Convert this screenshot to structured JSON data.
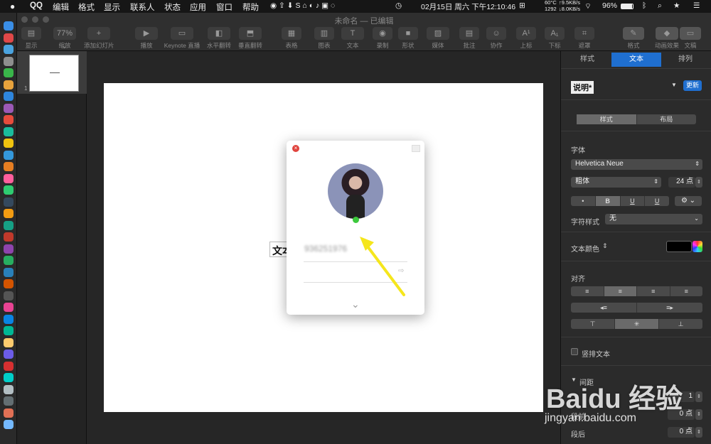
{
  "menubar": {
    "apple": "",
    "items": [
      "QQ",
      "编辑",
      "格式",
      "显示",
      "联系人",
      "状态",
      "应用",
      "窗口",
      "帮助"
    ],
    "cpu_temp": "60°C",
    "fan": "1292",
    "net_up": "↑9.5KB/s",
    "net_down": "↓8.0KB/s",
    "clock": "02月15日 周六 下午12:10:46",
    "battery": "96%"
  },
  "window": {
    "title": "未命名 — 已编辑"
  },
  "toolbar": {
    "items": [
      {
        "label": "显示",
        "icon": "view-icon"
      },
      {
        "label": "缩放",
        "value": "77%"
      },
      {
        "label": "添加幻灯片",
        "icon": "plus-icon"
      },
      {
        "label": "播放",
        "icon": "play-icon"
      },
      {
        "label": "Keynote 直播",
        "icon": "live-icon"
      },
      {
        "label": "水平翻转",
        "icon": "flip-h-icon"
      },
      {
        "label": "垂直翻转",
        "icon": "flip-v-icon"
      },
      {
        "label": "表格",
        "icon": "table-icon"
      },
      {
        "label": "图表",
        "icon": "chart-icon"
      },
      {
        "label": "文本",
        "icon": "text-icon"
      },
      {
        "label": "录制",
        "icon": "record-icon"
      },
      {
        "label": "形状",
        "icon": "shape-icon"
      },
      {
        "label": "媒体",
        "icon": "media-icon"
      },
      {
        "label": "批注",
        "icon": "comment-icon"
      },
      {
        "label": "协作",
        "icon": "collab-icon"
      },
      {
        "label": "上标",
        "icon": "superscript-icon"
      },
      {
        "label": "下标",
        "icon": "subscript-icon"
      },
      {
        "label": "遮罩",
        "icon": "mask-icon"
      },
      {
        "label": "格式",
        "icon": "format-icon"
      },
      {
        "label": "动画效果",
        "icon": "animate-icon"
      },
      {
        "label": "文稿",
        "icon": "document-icon"
      }
    ]
  },
  "thumbnails": {
    "slide_number": "1"
  },
  "slide": {
    "text_box": "文本"
  },
  "qq_login": {
    "account": "936251976",
    "chevron": "⌄"
  },
  "inspector": {
    "tabs": [
      "样式",
      "文本",
      "排列"
    ],
    "active_tab": "文本",
    "paragraph_style": "说明*",
    "update_button": "更新",
    "subtabs": [
      "样式",
      "布局"
    ],
    "font_section": "字体",
    "font_family": "Helvetica Neue",
    "font_weight": "粗体",
    "font_size": "24 点",
    "format_buttons": [
      "•",
      "B",
      "U",
      "U"
    ],
    "char_style_label": "字符样式",
    "char_style_value": "无",
    "text_color_label": "文本颜色",
    "text_color": "#000000",
    "align_section": "对齐",
    "vertical_text": "竖排文本",
    "spacing_section": "间距",
    "spacing_value": "1",
    "before_label": "段前",
    "before_value": "0 点",
    "after_label": "段后",
    "after_value": "0 点"
  },
  "watermark": {
    "brand": "Baidu 经验",
    "url": "jingyan.baidu.com"
  }
}
